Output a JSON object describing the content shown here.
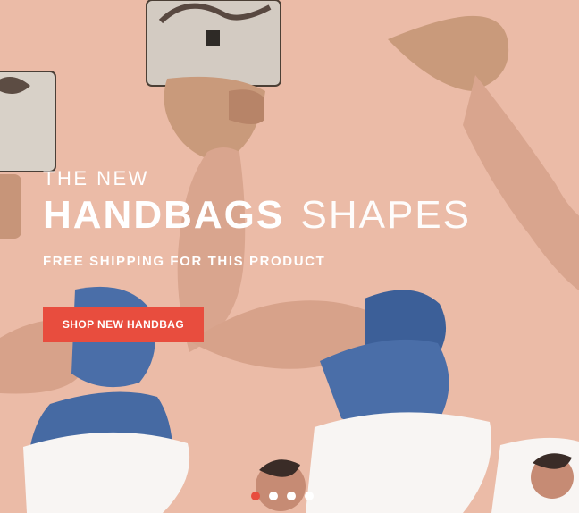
{
  "hero": {
    "eyebrow": "THE NEW",
    "headline_bold": "HANDBAGS",
    "headline_light": "SHAPES",
    "subline": "FREE SHIPPING FOR THIS PRODUCT",
    "cta_label": "SHOP NEW HANDBAG"
  },
  "slider": {
    "slide_count": 4,
    "active_index": 0
  },
  "colors": {
    "background": "#eab8a4",
    "accent": "#e84d3e",
    "text": "#ffffff"
  }
}
